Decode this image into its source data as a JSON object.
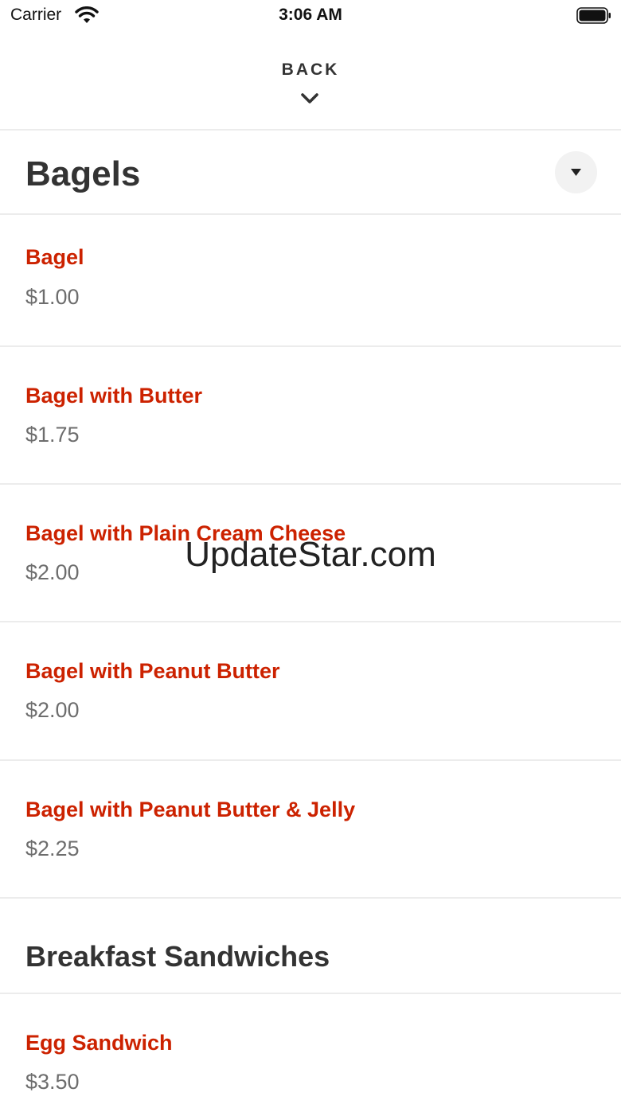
{
  "status_bar": {
    "carrier": "Carrier",
    "time": "3:06 AM"
  },
  "header": {
    "back_label": "BACK"
  },
  "categories": [
    {
      "title": "Bagels",
      "items": [
        {
          "name": "Bagel",
          "price": "$1.00"
        },
        {
          "name": "Bagel with Butter",
          "price": "$1.75"
        },
        {
          "name": "Bagel with Plain Cream Cheese",
          "price": "$2.00"
        },
        {
          "name": "Bagel with Peanut Butter",
          "price": "$2.00"
        },
        {
          "name": "Bagel with Peanut Butter & Jelly",
          "price": "$2.25"
        }
      ]
    },
    {
      "title": "Breakfast Sandwiches",
      "items": [
        {
          "name": "Egg Sandwich",
          "price": "$3.50"
        }
      ]
    }
  ],
  "watermark": "UpdateStar.com",
  "colors": {
    "item_name": "#cc2200",
    "price": "#6d6d6d",
    "title": "#333333",
    "divider": "#ececec"
  }
}
